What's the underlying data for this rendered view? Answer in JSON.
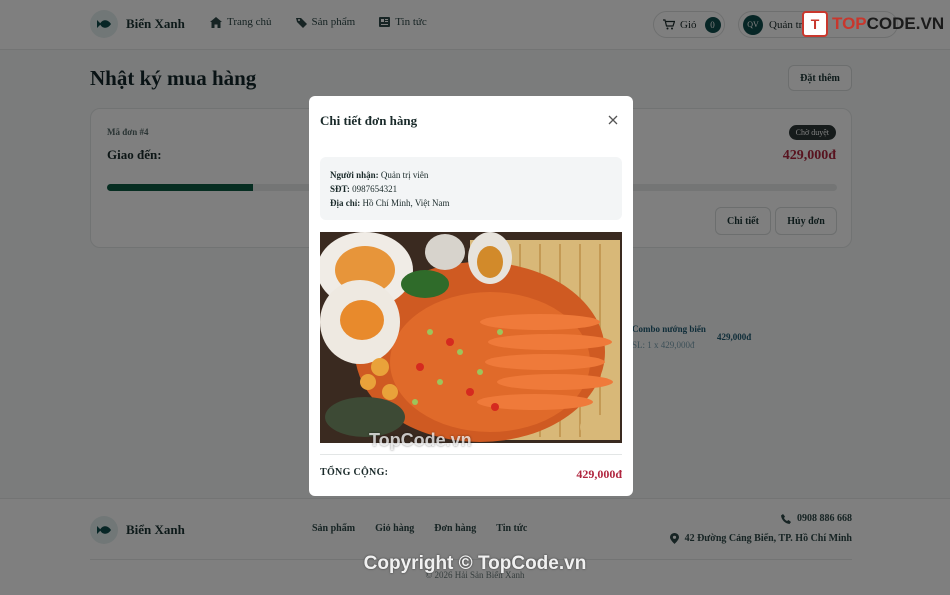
{
  "header": {
    "brand_name": "Biển Xanh",
    "nav": [
      {
        "label": "Trang chủ",
        "icon": "home-icon"
      },
      {
        "label": "Sản phẩm",
        "icon": "tag-icon"
      },
      {
        "label": "Tin tức",
        "icon": "news-icon"
      }
    ],
    "cart_label": "Giỏ",
    "cart_count": "0",
    "user_initials": "QV",
    "user_label": "Quản trị viên"
  },
  "main": {
    "page_title": "Nhật ký mua hàng",
    "reorder_label": "Đặt thêm",
    "order": {
      "code": "Mã đơn #4",
      "deliver_to": "Giao đến:",
      "status": "Chờ duyệt",
      "total": "429,000đ",
      "progress": 0.2,
      "detail_label": "Chi tiết",
      "cancel_label": "Hủy đơn"
    },
    "item": {
      "name": "Combo nướng biển",
      "qty": "SL: 1 x 429,000đ",
      "price": "429,000đ"
    }
  },
  "footer": {
    "brand_name": "Biển Xanh",
    "links": [
      "Sản phẩm",
      "Giỏ hàng",
      "Đơn hàng",
      "Tin tức"
    ],
    "phone": "0908 886 668",
    "address": "42 Đường Cảng Biển, TP. Hồ Chí Minh",
    "copyright": "© 2026 Hải Sản Biển Xanh"
  },
  "modal": {
    "title": "Chi tiết đơn hàng",
    "recipient_label": "Người nhận:",
    "recipient_value": "Quản trị viên",
    "phone_label": "SĐT:",
    "phone_value": "0987654321",
    "address_label": "Địa chỉ:",
    "address_value": "Hồ Chí Minh, Việt Nam",
    "total_label": "TỔNG CỘNG:",
    "total_value": "429,000đ"
  },
  "watermark": {
    "logo_mark": "T",
    "logo_top": "TOP",
    "logo_code": "CODE",
    "logo_vn": ".VN",
    "center_text": "TopCode.vn",
    "bottom_text": "Copyright © TopCode.vn"
  },
  "colors": {
    "brand_dark": "#0f4c4c",
    "price_red": "#b0263f",
    "progress_green": "#0d5a42"
  }
}
